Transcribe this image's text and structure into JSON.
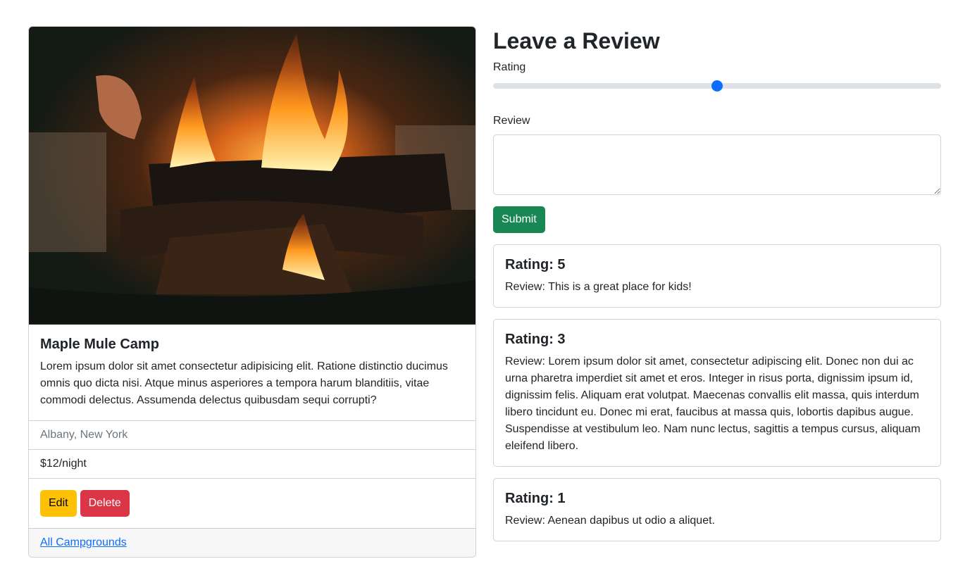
{
  "campground": {
    "title": "Maple Mule Camp",
    "description": "Lorem ipsum dolor sit amet consectetur adipisicing elit. Ratione distinctio ducimus omnis quo dicta nisi. Atque minus asperiores a tempora harum blanditiis, vitae commodi delectus. Assumenda delectus quibusdam sequi corrupti?",
    "location": "Albany, New York",
    "price": "$12/night",
    "edit_label": "Edit",
    "delete_label": "Delete",
    "all_link": "All Campgrounds"
  },
  "review_form": {
    "heading": "Leave a Review",
    "rating_label": "Rating",
    "rating_value": 3,
    "rating_min": 1,
    "rating_max": 5,
    "review_label": "Review",
    "review_value": "",
    "submit_label": "Submit"
  },
  "reviews": [
    {
      "rating": "Rating: 5",
      "text": "Review: This is a great place for kids!"
    },
    {
      "rating": "Rating: 3",
      "text": "Review: Lorem ipsum dolor sit amet, consectetur adipiscing elit. Donec non dui ac urna pharetra imperdiet sit amet et eros. Integer in risus porta, dignissim ipsum id, dignissim felis. Aliquam erat volutpat. Maecenas convallis elit massa, quis interdum libero tincidunt eu. Donec mi erat, faucibus at massa quis, lobortis dapibus augue. Suspendisse at vestibulum leo. Nam nunc lectus, sagittis a tempus cursus, aliquam eleifend libero."
    },
    {
      "rating": "Rating: 1",
      "text": "Review: Aenean dapibus ut odio a aliquet."
    }
  ],
  "colors": {
    "primary": "#0d6efd",
    "success": "#198754",
    "warning": "#ffc107",
    "danger": "#dc3545"
  }
}
